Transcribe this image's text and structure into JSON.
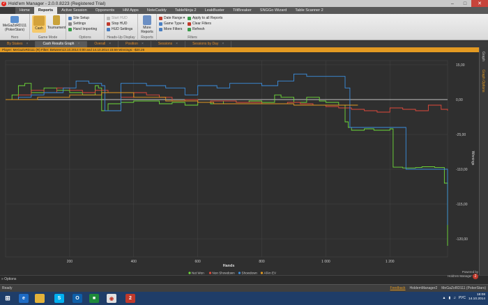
{
  "window": {
    "title": "Hold'em Manager - 2.0.0.8223 (Registered Trial)",
    "app_icon": "2"
  },
  "menu": {
    "tabs": [
      "",
      "Home",
      "Reports",
      "Active Session",
      "Opponents",
      "HM Apps",
      "NoteCaddy",
      "TableNinja 2",
      "LeakBuster",
      "TiltBreaker",
      "SNGGo Wizard",
      "Table Scanner 2"
    ],
    "active": "Reports"
  },
  "ribbon": {
    "player": {
      "name": "MeGaZoRD111",
      "site": "(PokerStars)"
    },
    "hero_label": "Hero",
    "game_mode": {
      "cash": "Cash",
      "tournament": "Tournament",
      "label": "Game Mode"
    },
    "options": {
      "site_setup": "Site Setup",
      "settings": "Settings",
      "hand_importing": "Hand Importing",
      "label": "Options"
    },
    "hud": {
      "start": "Start HUD",
      "stop": "Stop HUD",
      "settings": "HUD Settings",
      "label": "Heads-Up Display"
    },
    "reports": {
      "more": "More",
      "reports_menu": "Reports",
      "label": "Reports"
    },
    "filters": {
      "date_range": "Date Range",
      "game_type": "Game Type",
      "more_filters": "More Filters",
      "apply_all": "Apply to all Reports",
      "clear": "Clear Filters",
      "refresh": "Refresh",
      "label": "Filters"
    }
  },
  "subtabs": [
    {
      "label": "By Stakes",
      "active": false
    },
    {
      "label": "Cash Results Graph",
      "active": true
    },
    {
      "label": "Overall",
      "active": false
    },
    {
      "label": "Position",
      "active": false
    },
    {
      "label": "Sessions",
      "active": false
    },
    {
      "label": "Sessions by Day",
      "active": false
    }
  ],
  "filter_text": "Player: MeGaZoRD111 (R) Filter: Between13.10.2014 0:00 and 14.10.2014 23:59 Winnings: -$20.26",
  "side_tabs": {
    "graph": "Graph",
    "graph_options": "Graph Options"
  },
  "chart_data": {
    "type": "line",
    "xlabel": "Hands",
    "ylabel": "Winnings",
    "xlim": [
      0,
      1380
    ],
    "ylim": [
      -125,
      18
    ],
    "x_ticks": [
      "200",
      "400",
      "600",
      "800",
      "1 000",
      "1 200"
    ],
    "x_tick_values": [
      200,
      400,
      600,
      800,
      1000,
      1200
    ],
    "y_ticks": [
      "15,00",
      "0,00",
      "-25,00",
      "-110,00",
      "-115,00",
      "-120,00"
    ],
    "y_tick_values": [
      15,
      0,
      -25,
      -110,
      -115,
      -120
    ],
    "grid": true,
    "legend_position": "bottom",
    "series": [
      {
        "name": "Net Won",
        "color": "#6fdc3a",
        "x": [
          0,
          20,
          40,
          60,
          80,
          120,
          160,
          200,
          240,
          280,
          290,
          300,
          320,
          360,
          400,
          440,
          480,
          520,
          560,
          600,
          640,
          680,
          720,
          760,
          800,
          840,
          860,
          900,
          940,
          980,
          1000,
          1040,
          1060,
          1070,
          1080,
          1120,
          1150,
          1180,
          1200,
          1210,
          1240,
          1280,
          1300,
          1340,
          1370,
          1380
        ],
        "values": [
          0,
          2,
          6,
          7,
          3,
          5,
          4,
          3,
          2,
          6,
          5,
          -8,
          -3,
          -2,
          -1,
          -1,
          -3,
          -2,
          -4,
          -2,
          -3,
          -1,
          -2,
          -1,
          -2,
          2,
          1,
          -2,
          1,
          -1,
          -2,
          -4,
          -16,
          -20,
          -22,
          -21,
          -22,
          -22,
          -21,
          -105,
          -107,
          -106,
          -104,
          -106,
          -112,
          -121
        ]
      },
      {
        "name": "Non Showdown",
        "color": "#e24a3b",
        "x": [
          0,
          40,
          80,
          120,
          160,
          200,
          240,
          280,
          320,
          360,
          400,
          440,
          480,
          520,
          560,
          600,
          640,
          680,
          720,
          760,
          800,
          840,
          880,
          920,
          960,
          1000,
          1040,
          1080,
          1120,
          1160,
          1200,
          1240,
          1280,
          1320,
          1360,
          1380
        ],
        "values": [
          0,
          2,
          4,
          3,
          5,
          4,
          3,
          4,
          3,
          1,
          3,
          2,
          1,
          -1,
          0,
          -2,
          -1,
          -1,
          -2,
          -2,
          -3,
          -3,
          -2,
          -3,
          -4,
          -5,
          -6,
          -7,
          -8,
          -9,
          -6,
          -7,
          -8,
          -4,
          -7,
          -8
        ]
      },
      {
        "name": "Showdown",
        "color": "#3b8fe0",
        "x": [
          0,
          40,
          80,
          120,
          180,
          220,
          260,
          300,
          310,
          360,
          440,
          500,
          560,
          600,
          660,
          700,
          760,
          800,
          850,
          900,
          940,
          980,
          1040,
          1060,
          1075,
          1100,
          1140,
          1180,
          1200,
          1220,
          1250,
          1290,
          1320,
          1360,
          1370,
          1380
        ],
        "values": [
          0,
          1,
          2,
          3,
          5,
          8,
          7,
          6,
          -8,
          7,
          6,
          5,
          2,
          6,
          5,
          7,
          7,
          6,
          8,
          11,
          10,
          10,
          10,
          5,
          -20,
          -20,
          -20,
          -20,
          -20,
          -20,
          -110,
          -110,
          -110,
          -110,
          -110,
          -118
        ]
      },
      {
        "name": "All-in EV",
        "color": "#e39a22",
        "x": [
          0,
          100,
          200,
          300,
          400,
          500,
          600,
          650,
          700,
          800,
          900,
          1000,
          1100
        ],
        "values": [
          0,
          1,
          2,
          3,
          1,
          -1,
          -2,
          -3,
          -3,
          -3,
          -4,
          -4,
          -4
        ]
      }
    ]
  },
  "bottom": {
    "options_label": "Options",
    "powered_by": "Powered by",
    "brand_name": "Hold'em Manager"
  },
  "status": {
    "ready": "Ready",
    "feedback": "Feedback",
    "app": "HoldemManager2",
    "player": "MeGaZoRD111 (PokerStars)"
  },
  "taskbar": {
    "time": "18:08",
    "date": "14.10.2014",
    "lang": "РУС"
  }
}
